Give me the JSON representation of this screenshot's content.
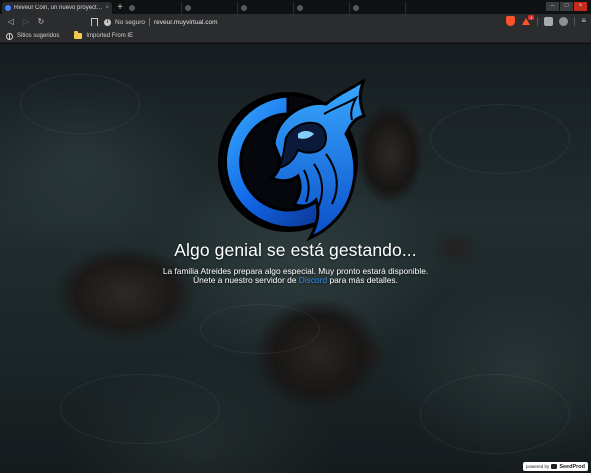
{
  "browser": {
    "tabs": [
      {
        "title": "Reveur Coin, un nuevo proyecto cr",
        "active": true
      },
      {
        "title": "",
        "active": false
      },
      {
        "title": "",
        "active": false
      },
      {
        "title": "",
        "active": false
      },
      {
        "title": "",
        "active": false
      },
      {
        "title": "",
        "active": false
      }
    ],
    "new_tab_label": "+",
    "close_glyph": "×",
    "security_label": "No seguro",
    "url": "reveur.muyvirtual.com",
    "rewards_badge": "4",
    "icons": {
      "back": "back-arrow-icon",
      "forward": "forward-arrow-icon",
      "reload": "reload-icon",
      "bookmark": "bookmark-icon",
      "info": "info-icon",
      "brave": "brave-shield-icon",
      "rewards": "rewards-icon",
      "menu": "menu-icon"
    }
  },
  "bookmarks": [
    {
      "label": "Sitios sugeridos",
      "icon": "globe-icon"
    },
    {
      "label": "Imported From IE",
      "icon": "folder-icon"
    }
  ],
  "page": {
    "headline": "Algo genial se está gestando...",
    "line1": "La familia Atreides prepara algo especial. Muy pronto estará disponible.",
    "line2_before": "Únete a nuestro servidor de ",
    "line2_link": "Discord",
    "line2_after": " para más detalles.",
    "powered_prefix": "powered by",
    "powered_brand": "SeedProd",
    "colors": {
      "link": "#2f8df2",
      "logo_blue": "#1a8cff",
      "logo_dark": "#0a2a66"
    }
  }
}
